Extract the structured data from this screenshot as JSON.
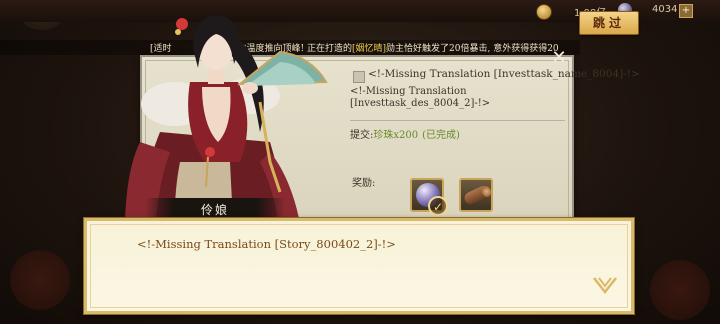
{
  "colors": {
    "accent_gold": "#d9b96a",
    "dialog_text": "#7a4a18",
    "highlight": "#f2c94c",
    "complete_green": "#6a8a2a"
  },
  "topbar": {
    "coin_icon": "gold-coin-icon",
    "coin_value": "1.08亿",
    "pearl_icon": "pearl-icon",
    "pearl_value": "4034",
    "plus_label": "+",
    "skip_label": "跳过"
  },
  "ticker": {
    "prefix": "[适时",
    "text_a": "炼炉内温度推向顶峰! 正在打造的",
    "name": "[姻忆晴]",
    "text_b": "勋主恰好触发了20倍暴击, 意外获得获得20"
  },
  "task": {
    "name": "<!-Missing Translation  [Investtask_name_8004]-!>",
    "description": "<!-Missing Translation  [Investtask_des_8004_2]-!>",
    "submit_label": "提交:",
    "submit_item": "珍珠x200",
    "submit_status": "(已完成)",
    "reward_label": "奖励:",
    "rewards": [
      {
        "icon": "pearl-reward-icon"
      },
      {
        "icon": "wood-log-icon"
      }
    ],
    "completed_mark": "✓",
    "close_label": "✕"
  },
  "speaker": {
    "name": "伶娘"
  },
  "dialog": {
    "text": "<!-Missing Translation  [Story_800402_2]-!>"
  }
}
